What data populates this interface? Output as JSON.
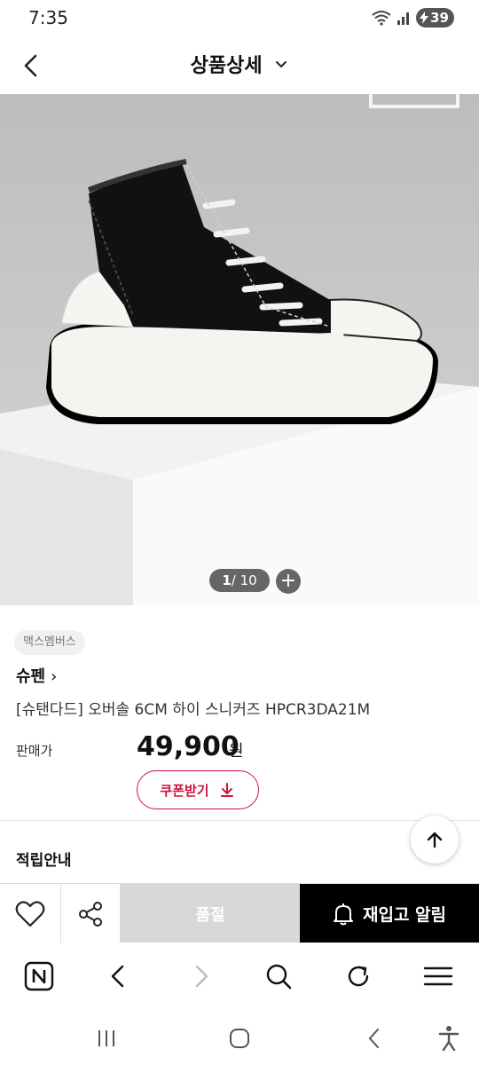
{
  "status": {
    "time": "7:35",
    "battery": "39"
  },
  "header": {
    "title": "상품상세"
  },
  "gallery": {
    "current": "1",
    "total": "/ 10",
    "plus": "+"
  },
  "product": {
    "badge": "맥스멤버스",
    "brand": "슈펜",
    "brand_arrow": "›",
    "name": "[슈탠다드] 오버솔 6CM 하이 스니커즈 HPCR3DA21M",
    "price_label": "판매가",
    "price": "49,900",
    "price_unit": "원",
    "coupon_label": "쿠폰받기"
  },
  "reward": {
    "title": "적립안내"
  },
  "actions": {
    "soldout_label": "품절",
    "restock_label": "재입고 알림"
  },
  "colors": {
    "accent": "#d2103c",
    "restock_bg": "#000000",
    "soldout_bg": "#d8d8d8"
  },
  "icons": {
    "header": [
      "back-arrow-icon",
      "chevron-down-icon"
    ],
    "bottom": [
      "heart-icon",
      "share-icon",
      "bell-icon"
    ],
    "browser": [
      "naver-home-icon",
      "back-icon",
      "forward-icon",
      "search-icon",
      "refresh-icon",
      "menu-icon"
    ],
    "system": [
      "recents-icon",
      "home-icon",
      "system-back-icon",
      "accessibility-icon"
    ]
  }
}
